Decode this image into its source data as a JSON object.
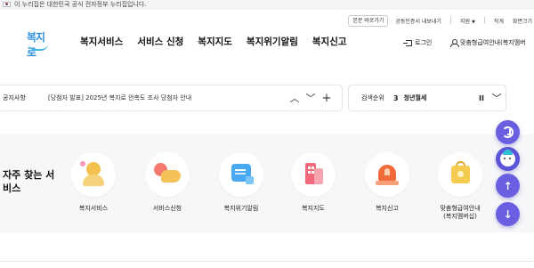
{
  "gov_banner": {
    "text": "이 누리집은 대한민국 공식 전자정부 누리집입니다."
  },
  "header": {
    "utility": {
      "shortcut": "본문 바로가기",
      "cert": "공동인증서 내보내기",
      "support": "지원",
      "font_size": "작게",
      "zoom": "화면크기"
    },
    "logo_text": "복지로",
    "nav": [
      "복지서비스",
      "서비스 신청",
      "복지지도",
      "복지위기알림",
      "복지신고"
    ],
    "login": "로그인",
    "my_service": "맞춤형급여안내(복지멤버"
  },
  "notice": {
    "label": "공지사항",
    "text": "[당첨자 발표] 2025년 복지로 안촉도 조사 당첨자 안내",
    "prev_icon": "chevron-up",
    "next_icon": "chevron-down",
    "more_icon": "plus"
  },
  "ranking": {
    "label": "검색순위",
    "rank": "3",
    "term": "청년월세",
    "pause": "II",
    "toggle": "⌄"
  },
  "favorites": {
    "title": "자주 찾는 서비스",
    "items": [
      {
        "label": "복지서비스",
        "icon": "person-icon"
      },
      {
        "label": "서비스신청",
        "icon": "hand-icon"
      },
      {
        "label": "복지위기알림",
        "icon": "document-icon"
      },
      {
        "label": "복지지도",
        "icon": "map-icon"
      },
      {
        "label": "복지신고",
        "icon": "siren-icon"
      },
      {
        "label": "맞춤형급여안내",
        "label2": "(복지멤버십)",
        "icon": "membership-icon"
      }
    ]
  },
  "floating": {
    "history_icon": "history-icon",
    "chatbot_icon": "chatbot-icon",
    "up": "↑",
    "down": "↓"
  },
  "colors": {
    "accent": "#6a5fe0",
    "logo_blue": "#2f8fd8",
    "section_bg": "#f6f7f9"
  }
}
